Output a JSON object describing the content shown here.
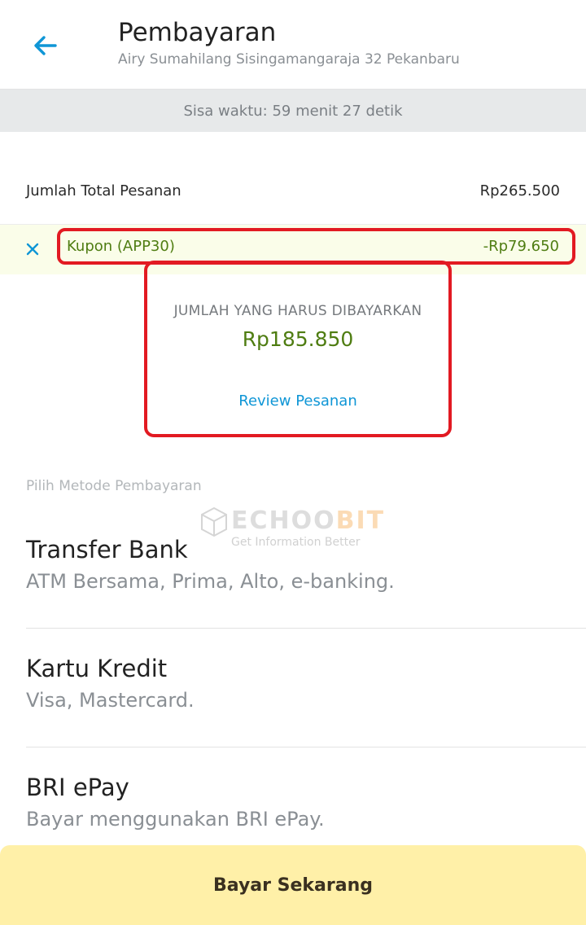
{
  "header": {
    "title": "Pembayaran",
    "subtitle": "Airy Sumahilang Sisingamangaraja 32 Pekanbaru",
    "back_icon": "arrow-left-icon"
  },
  "timer": {
    "text": "Sisa waktu: 59 menit 27 detik"
  },
  "order": {
    "total_label": "Jumlah Total Pesanan",
    "total_value": "Rp265.500"
  },
  "coupon": {
    "label": "Kupon (APP30)",
    "value": "-Rp79.650",
    "remove_icon": "close-icon"
  },
  "payment": {
    "label": "JUMLAH YANG HARUS DIBAYARKAN",
    "amount": "Rp185.850",
    "review_link": "Review Pesanan"
  },
  "methods_heading": "Pilih Metode Pembayaran",
  "methods": [
    {
      "title": "Transfer Bank",
      "desc": "ATM Bersama, Prima, Alto, e-banking."
    },
    {
      "title": "Kartu Kredit",
      "desc": "Visa, Mastercard."
    },
    {
      "title": "BRI ePay",
      "desc": "Bayar menggunakan BRI ePay."
    }
  ],
  "watermark": {
    "brand_a": "ECHOO",
    "brand_b": "BIT",
    "tagline": "Get Information Better"
  },
  "pay_button": "Bayar Sekarang",
  "colors": {
    "accent_blue": "#0f96d6",
    "discount_green": "#4f7d12",
    "highlight_red": "#e21a22",
    "button_yellow": "#fff0a8"
  }
}
